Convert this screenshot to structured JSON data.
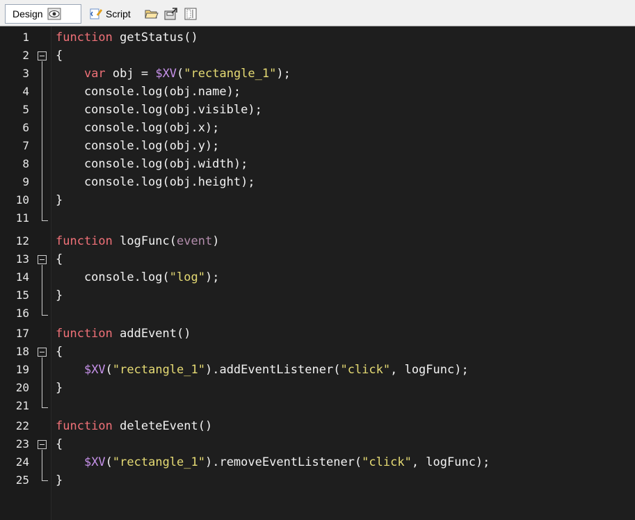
{
  "toolbar": {
    "design_label": "Design",
    "script_label": "Script",
    "icons": [
      "eye-icon",
      "script-icon",
      "open-folder-icon",
      "export-icon",
      "panel-icon"
    ]
  },
  "editor": {
    "lines": [
      {
        "num": "1",
        "text": "function getStatus()"
      },
      {
        "num": "2",
        "text": "{"
      },
      {
        "num": "3",
        "text": "    var obj = $XV(\"rectangle_1\");"
      },
      {
        "num": "4",
        "text": "    console.log(obj.name);"
      },
      {
        "num": "5",
        "text": "    console.log(obj.visible);"
      },
      {
        "num": "6",
        "text": "    console.log(obj.x);"
      },
      {
        "num": "7",
        "text": "    console.log(obj.y);"
      },
      {
        "num": "8",
        "text": "    console.log(obj.width);"
      },
      {
        "num": "9",
        "text": "    console.log(obj.height);"
      },
      {
        "num": "10",
        "text": "}"
      },
      {
        "num": "11",
        "text": ""
      },
      {
        "num": "12",
        "text": "function logFunc(event)"
      },
      {
        "num": "13",
        "text": "{"
      },
      {
        "num": "14",
        "text": "    console.log(\"log\");"
      },
      {
        "num": "15",
        "text": "}"
      },
      {
        "num": "16",
        "text": ""
      },
      {
        "num": "17",
        "text": "function addEvent()"
      },
      {
        "num": "18",
        "text": "{"
      },
      {
        "num": "19",
        "text": "    $XV(\"rectangle_1\").addEventListener(\"click\", logFunc);"
      },
      {
        "num": "20",
        "text": "}"
      },
      {
        "num": "21",
        "text": ""
      },
      {
        "num": "22",
        "text": "function deleteEvent()"
      },
      {
        "num": "23",
        "text": "{"
      },
      {
        "num": "24",
        "text": "    $XV(\"rectangle_1\").removeEventListener(\"click\", logFunc);"
      },
      {
        "num": "25",
        "text": "}"
      }
    ]
  },
  "colors": {
    "background": "#1e1e1e",
    "keyword": "#f07178",
    "string": "#e6db74",
    "xv_function": "#c792ea",
    "parameter": "#b48ead",
    "text": "#f2f2f2"
  }
}
